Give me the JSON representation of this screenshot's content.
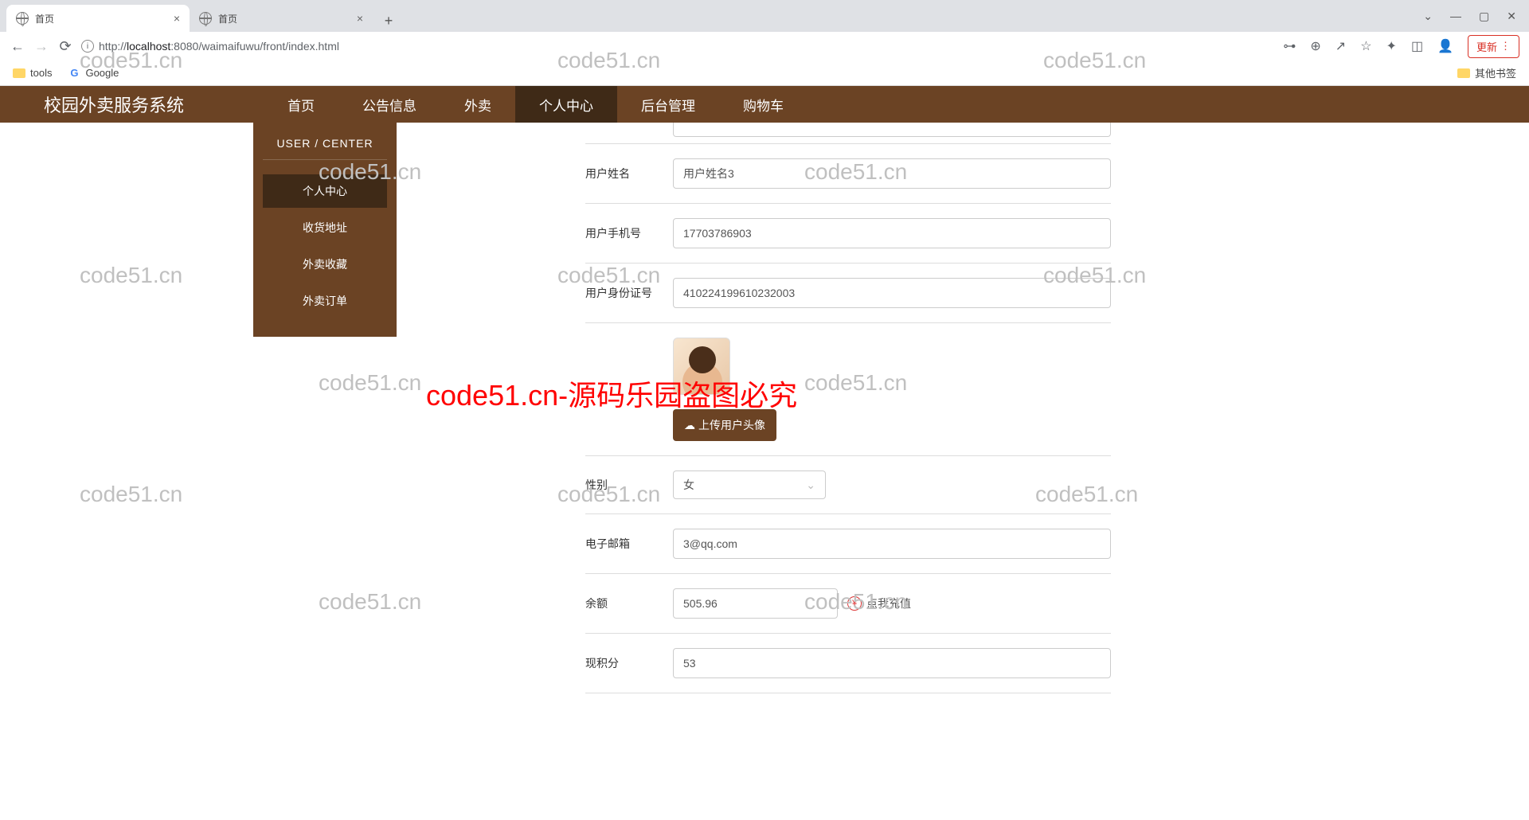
{
  "browser": {
    "tabs": [
      {
        "title": "首页"
      },
      {
        "title": "首页"
      }
    ],
    "url_host": "localhost",
    "url_port": ":8080",
    "url_path": "/waimaifuwu/front/index.html",
    "update": "更新",
    "bookmarks": {
      "tools": "tools",
      "google": "Google",
      "other": "其他书签"
    }
  },
  "nav": {
    "brand": "校园外卖服务系统",
    "items": [
      "首页",
      "公告信息",
      "外卖",
      "个人中心",
      "后台管理",
      "购物车"
    ]
  },
  "sidebar": {
    "head": "USER / CENTER",
    "items": [
      "个人中心",
      "收货地址",
      "外卖收藏",
      "外卖订单"
    ]
  },
  "form": {
    "username_label": "用户姓名",
    "username": "用户姓名3",
    "phone_label": "用户手机号",
    "phone": "17703786903",
    "id_label": "用户身份证号",
    "id": "410224199610232003",
    "upload": "上传用户头像",
    "gender_label": "性别",
    "gender": "女",
    "email_label": "电子邮箱",
    "email": "3@qq.com",
    "balance_label": "余额",
    "balance": "505.96",
    "recharge": "点我充值",
    "points_label": "现积分",
    "points": "53"
  },
  "watermark": "code51.cn",
  "red_watermark": "code51.cn-源码乐园盗图必究"
}
